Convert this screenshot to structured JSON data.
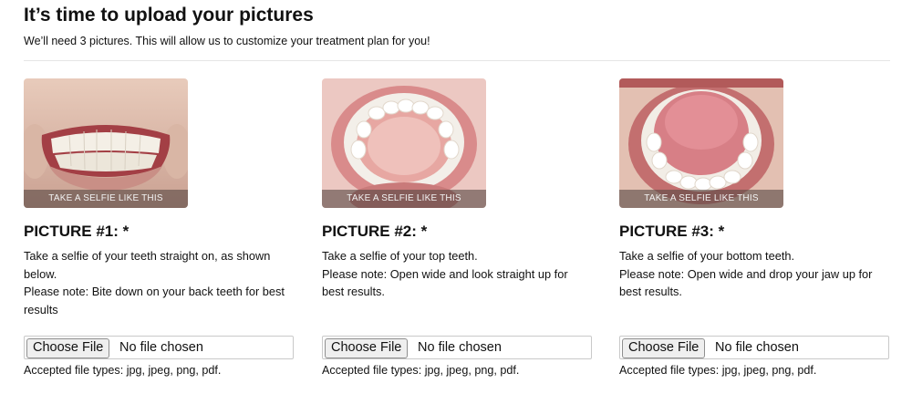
{
  "page": {
    "title": "It’s time to upload your pictures",
    "subtitle": "We’ll need 3 pictures. This will allow us to customize your treatment plan for you!"
  },
  "pictures": [
    {
      "heading": "PICTURE #1: *",
      "overlay": "TAKE A SELFIE LIKE THIS",
      "lines": [
        "Take a selfie of your teeth straight on, as shown below.",
        "Please note: Bite down on your back teeth for best results"
      ],
      "file_button": "Choose File",
      "file_status": "No file chosen",
      "accepted": "Accepted file types: jpg, jpeg, png, pdf."
    },
    {
      "heading": "PICTURE #2: *",
      "overlay": "TAKE A SELFIE LIKE THIS",
      "lines": [
        "Take a selfie of your top teeth.",
        "Please note: Open wide and look straight up for best results."
      ],
      "file_button": "Choose File",
      "file_status": "No file chosen",
      "accepted": "Accepted file types: jpg, jpeg, png, pdf."
    },
    {
      "heading": "PICTURE #3: *",
      "overlay": "TAKE A SELFIE LIKE THIS",
      "lines": [
        "Take a selfie of your bottom teeth.",
        "Please note: Open wide and drop your jaw up for best results."
      ],
      "file_button": "Choose File",
      "file_status": "No file chosen",
      "accepted": "Accepted file types: jpg, jpeg, png, pdf."
    }
  ]
}
